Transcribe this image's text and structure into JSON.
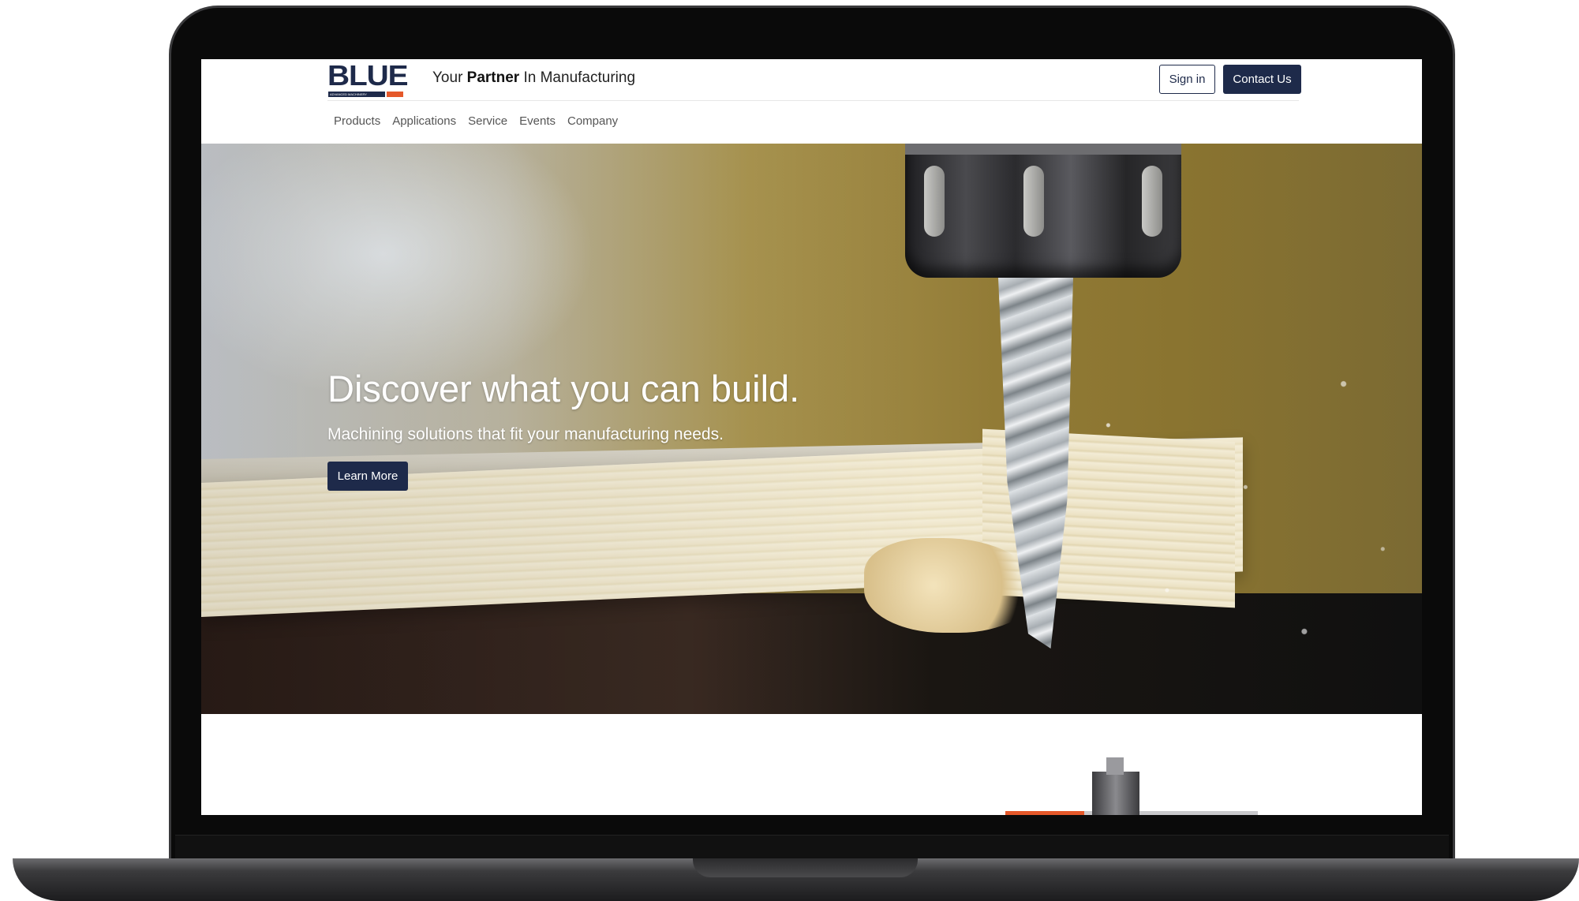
{
  "brand": {
    "logo_text": "BLUE",
    "logo_subtext": "ADVANCED MACHINERY",
    "tagline_prefix": "Your ",
    "tagline_bold": "Partner",
    "tagline_suffix": " In Manufacturing",
    "colors": {
      "primary": "#1e2a4a",
      "accent": "#e5582a"
    }
  },
  "header": {
    "signin_label": "Sign in",
    "contact_label": "Contact Us"
  },
  "nav": {
    "items": [
      "Products",
      "Applications",
      "Service",
      "Events",
      "Company"
    ]
  },
  "hero": {
    "title": "Discover what you can build.",
    "subtitle": "Machining solutions that fit your manufacturing needs.",
    "cta_label": "Learn More"
  }
}
